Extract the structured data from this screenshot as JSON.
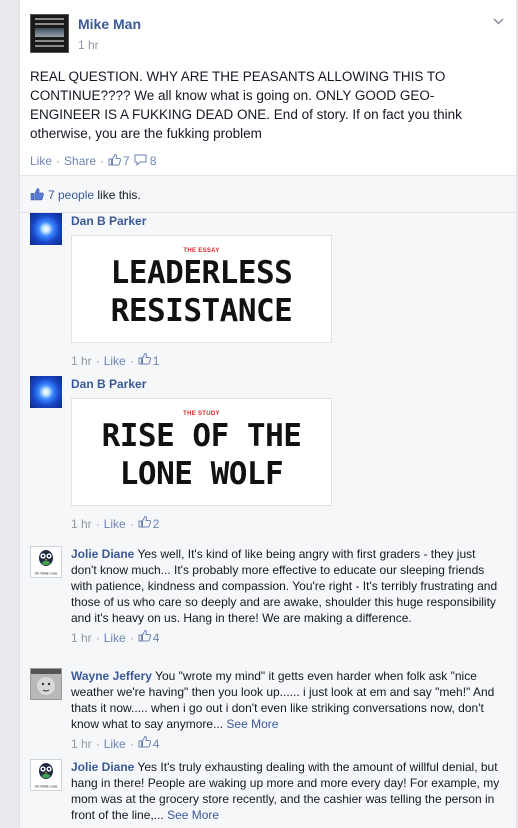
{
  "post": {
    "author": "Mike Man",
    "time": "1 hr",
    "text": "REAL QUESTION. WHY ARE THE PEASANTS ALLOWING THIS TO CONTINUE???? We all know what is going on. ONLY GOOD GEO-ENGINEER IS A FUKKING DEAD ONE. End of story. If on fact you think otherwise, you are the fukking problem",
    "like_label": "Like",
    "share_label": "Share",
    "like_count": "7",
    "comment_count": "8",
    "likes_summary_link": "7 people",
    "likes_summary_rest": " like this."
  },
  "comments": [
    {
      "name": "Dan B Parker",
      "text": "",
      "attachment": {
        "kicker": "THE ESSAY",
        "line1": "LEADERLESS",
        "line2": "RESISTANCE"
      },
      "time": "1 hr",
      "like_label": "Like",
      "likes": "1"
    },
    {
      "name": "Dan B Parker",
      "text": "",
      "attachment": {
        "kicker": "THE STUDY",
        "line1": "RISE OF THE",
        "line2": "LONE WOLF"
      },
      "time": "1 hr",
      "like_label": "Like",
      "likes": "2"
    },
    {
      "name": "Jolie Diane",
      "text": "Yes well, It's kind of like being angry with first graders - they just don't know much... It's probably more effective to educate our sleeping friends with patience, kindness and compassion. You're right - It's terribly frustrating and those of us who care so deeply and are awake, shoulder this huge responsibility and it's heavy on us. Hang in there! We are making a difference.",
      "time": "1 hr",
      "like_label": "Like",
      "likes": "4"
    },
    {
      "name": "Wayne Jeffery",
      "text": "You \"wrote my mind\" it getts even harder when folk ask \"nice weather we're having\" then you look up...... i just look at em and say \"meh!\" And thats it now..... when i go out i don't even like striking conversations now, don't know what to say anymore...",
      "see_more": "See More",
      "time": "1 hr",
      "like_label": "Like",
      "likes": "4"
    },
    {
      "name": "Jolie Diane",
      "text": "Yes It's truly exhausting dealing with the amount of willful denial, but hang in there! People are waking up more and more every day! For example, my mom was at the grocery store recently, and the cashier was telling the person in front of the line,...",
      "see_more": "See More"
    }
  ],
  "owl_caption": "On Wide Love",
  "colors": {
    "link": "#3b5998",
    "meta": "#9197a3",
    "background": "#e9eaed"
  }
}
